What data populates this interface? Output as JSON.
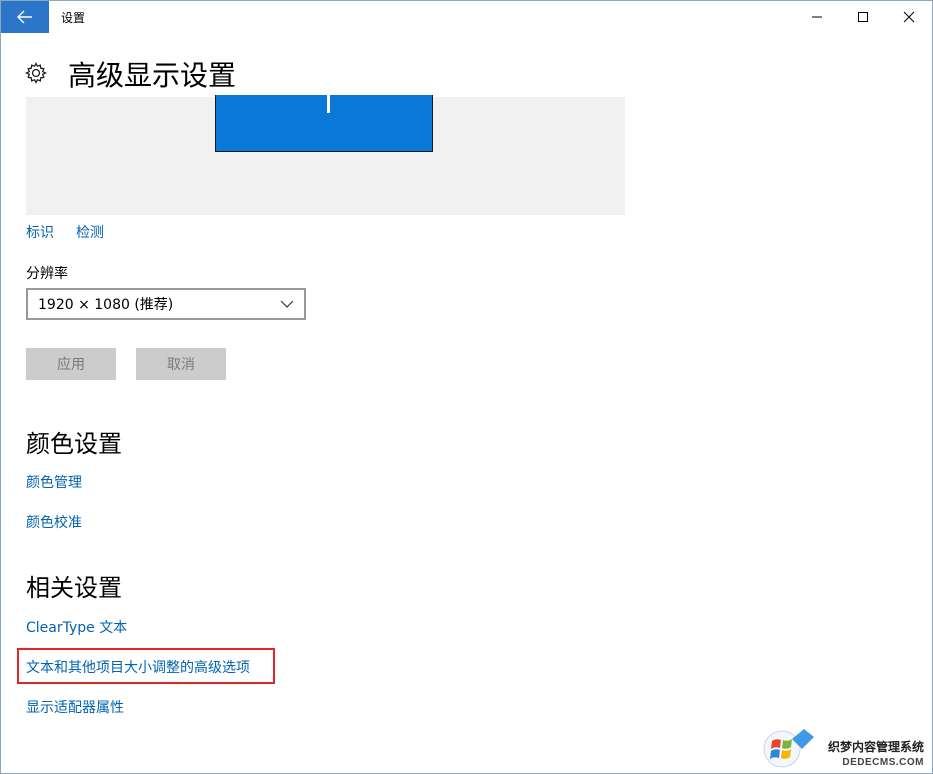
{
  "window": {
    "title": "设置"
  },
  "header": {
    "title": "高级显示设置"
  },
  "display": {
    "identify_label": "标识",
    "detect_label": "检测"
  },
  "resolution": {
    "label": "分辨率",
    "value": "1920 × 1080 (推荐)"
  },
  "buttons": {
    "apply": "应用",
    "cancel": "取消"
  },
  "color_settings": {
    "title": "颜色设置",
    "links": [
      "颜色管理",
      "颜色校准"
    ]
  },
  "related_settings": {
    "title": "相关设置",
    "links": [
      "ClearType 文本",
      "文本和其他项目大小调整的高级选项",
      "显示适配器属性"
    ]
  },
  "watermark": {
    "line1": "织梦内容管理系统",
    "line2": "DEDECMS.COM"
  },
  "colors": {
    "accent": "#0063b1",
    "titlebar_back": "#2b76c8",
    "monitor": "#0a78d7",
    "highlight": "#e0262a"
  }
}
